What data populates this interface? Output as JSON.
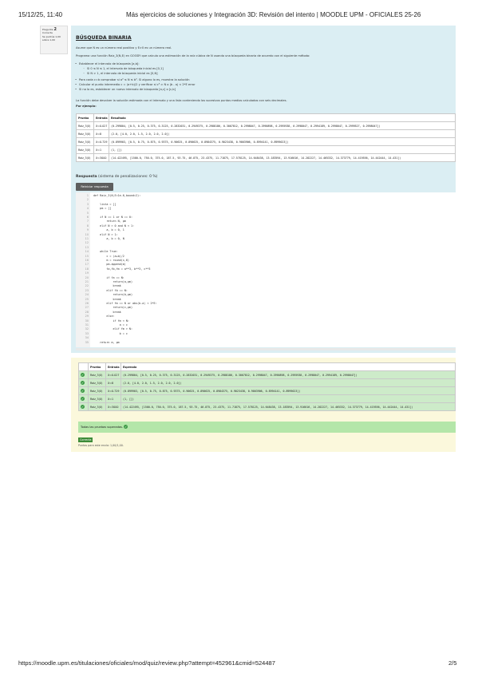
{
  "header": {
    "date": "15/12/25, 11:40",
    "title": "Más ejercicios de soluciones y Integración 3D: Revisión del intento | MOODLE UPM - OFICIALES 25-26"
  },
  "question_info": {
    "label": "Pregunta",
    "number": "2",
    "status": "Correcta",
    "points": "Se puntúa 1,00 sobre 1,00"
  },
  "question": {
    "title": "BÚSQUEDA BINARIA",
    "intro": "Asume que N es un número real positivo y E>0 es un número real.",
    "task": "Programa una función Raiz_3(N,E) en GOODY que calcula una estimación de la raíz cúbica de N usando una búsqueda binaria de acuerdo con el siguiente método:",
    "steps": [
      "Establecer el intervalo de búsqueda [a,b]:",
      "Para cada c=b comprobar si a³ ≤ N ≤ b³. Si alguno lo es, muestra la solución",
      "Calcular el punto intermedio c = (a+b)/2 y verificar si c³ ≈ N o |b - a| < 2*E error",
      "Si no lo es, establecer un nuevo intervalo de búsqueda [a,c] o [c,b]"
    ],
    "substeps": [
      "Si 0 ≤ N ≤ 1, el intervalo de búsqueda inicial es [0,1]",
      "Si N > 1, el intervalo de búsqueda inicial es [0,N]"
    ],
    "closing": "La función debe devolver la solución estimada con el intervalo y una lista conteniendo los sucesivos puntos medios calculados con seis decimales.",
    "example_label": "Por ejemplo:",
    "example_headers": [
      "Prueba",
      "Entrada",
      "Resultado"
    ],
    "example_rows": [
      [
        "Raiz_3(X)",
        "X=0.027",
        "(0.299804, [0.5, 0.25, 0.375, 0.3125, 0.2832031, 0.2949375, 0.2988186, 0.3007812, 0.2998047, 0.2990898, 0.2995938, 0.2998047, 0.2994189, 0.2998047, 0.2999527, 0.2998047])"
      ],
      [
        "Raiz_3(X)",
        "X=8",
        "(2.0, [4.0, 2.0, 1.5, 2.0, 2.0, 2.0])"
      ],
      [
        "Raiz_3(X)",
        "X=0.729",
        "(0.899903, [0.5, 0.75, 0.875, 0.9375, 0.90625, 0.890625, 0.8984375, 0.9023438, 0.9003906, 0.8994141, 0.8999023])"
      ],
      [
        "Raiz_3(X)",
        "X=1",
        "(1, [])"
      ],
      [
        "Raiz_3(X)",
        "X=3000",
        "(14.422495, [1500.0, 750.0, 375.0, 187.5, 93.75, 46.875, 23.4375, 11.71875, 17.578125, 14.648438, 13.183594, 13.916016, 14.282227, 14.465332, 14.373779, 14.419556, 14.442444, 14.431])"
      ]
    ]
  },
  "answer": {
    "label": "Respuesta",
    "penalty": "(sistema de penalizaciones: 0 %)",
    "precheck_label": "Reiniciar respuesta",
    "code_lines": [
      "def Raiz_3(N,E=1e-6,bound=2):",
      "",
      "    lista = []",
      "    pm = []",
      "",
      "    if N == 1 or N == 0:",
      "        return N, pm",
      "    elif N > 0 and N < 1:",
      "        a, b = 0, 1",
      "    elif N > 1:",
      "        a, b = 0, N",
      "",
      "",
      "    while True:",
      "        c = (a+b)/2",
      "        m = round(c,6)",
      "        pm.append(m)",
      "        fa,fb,fm = a**3, b**3, c**3",
      "",
      "        if fa == N:",
      "            return(a,pm)",
      "            break",
      "        elif fb == N:",
      "            return(b,pm)",
      "            break",
      "        elif fm == N or abs(b-a) < 2*E:",
      "            return(c,pm)",
      "            break",
      "        else:",
      "            if fm < N:",
      "                a = c",
      "            elif fm > N:",
      "                b = c",
      "",
      "    return m, pm"
    ]
  },
  "results": {
    "headers": [
      "",
      "Prueba",
      "Entrada",
      "Esperado"
    ],
    "rows": [
      [
        "Raiz_3(X)",
        "X=0.027",
        "(0.299804, [0.5, 0.25, 0.375, 0.3125, 0.2832031, 0.2949375, 0.2988186, 0.3007812, 0.2998047, 0.2990898, 0.2995938, 0.2998047, 0.2994189, 0.2998047])"
      ],
      [
        "Raiz_3(X)",
        "X=8",
        "(2.0, [4.0, 2.0, 1.5, 2.0, 2.0, 2.0])"
      ],
      [
        "Raiz_3(X)",
        "X=0.729",
        "(0.899903, [0.5, 0.75, 0.875, 0.9375, 0.90625, 0.890625, 0.8984375, 0.9023438, 0.9003906, 0.8994141, 0.8999023])"
      ],
      [
        "Raiz_3(X)",
        "X=1",
        "(1, [])"
      ],
      [
        "Raiz_3(X)",
        "X=3000",
        "(14.422495, [1500.0, 750.0, 375.0, 187.5, 93.75, 46.875, 23.4375, 11.71875, 17.578125, 14.648438, 13.183594, 13.916016, 14.282227, 14.465332, 14.373779, 14.419556, 14.442444, 14.431])"
      ]
    ],
    "all_passed": "Todas las pruebas superadas.",
    "status_badge": "Correcta",
    "grade": "Puntos para este envío: 1,00/1,00."
  },
  "footer": {
    "url": "https://moodle.upm.es/titulaciones/oficiales/mod/quiz/review.php?attempt=452961&cmid=524487",
    "page": "2/5"
  },
  "colors": {
    "question_bg": "#dbeef3",
    "result_bg": "#fbf8dc",
    "pass": "#3c9a44"
  }
}
